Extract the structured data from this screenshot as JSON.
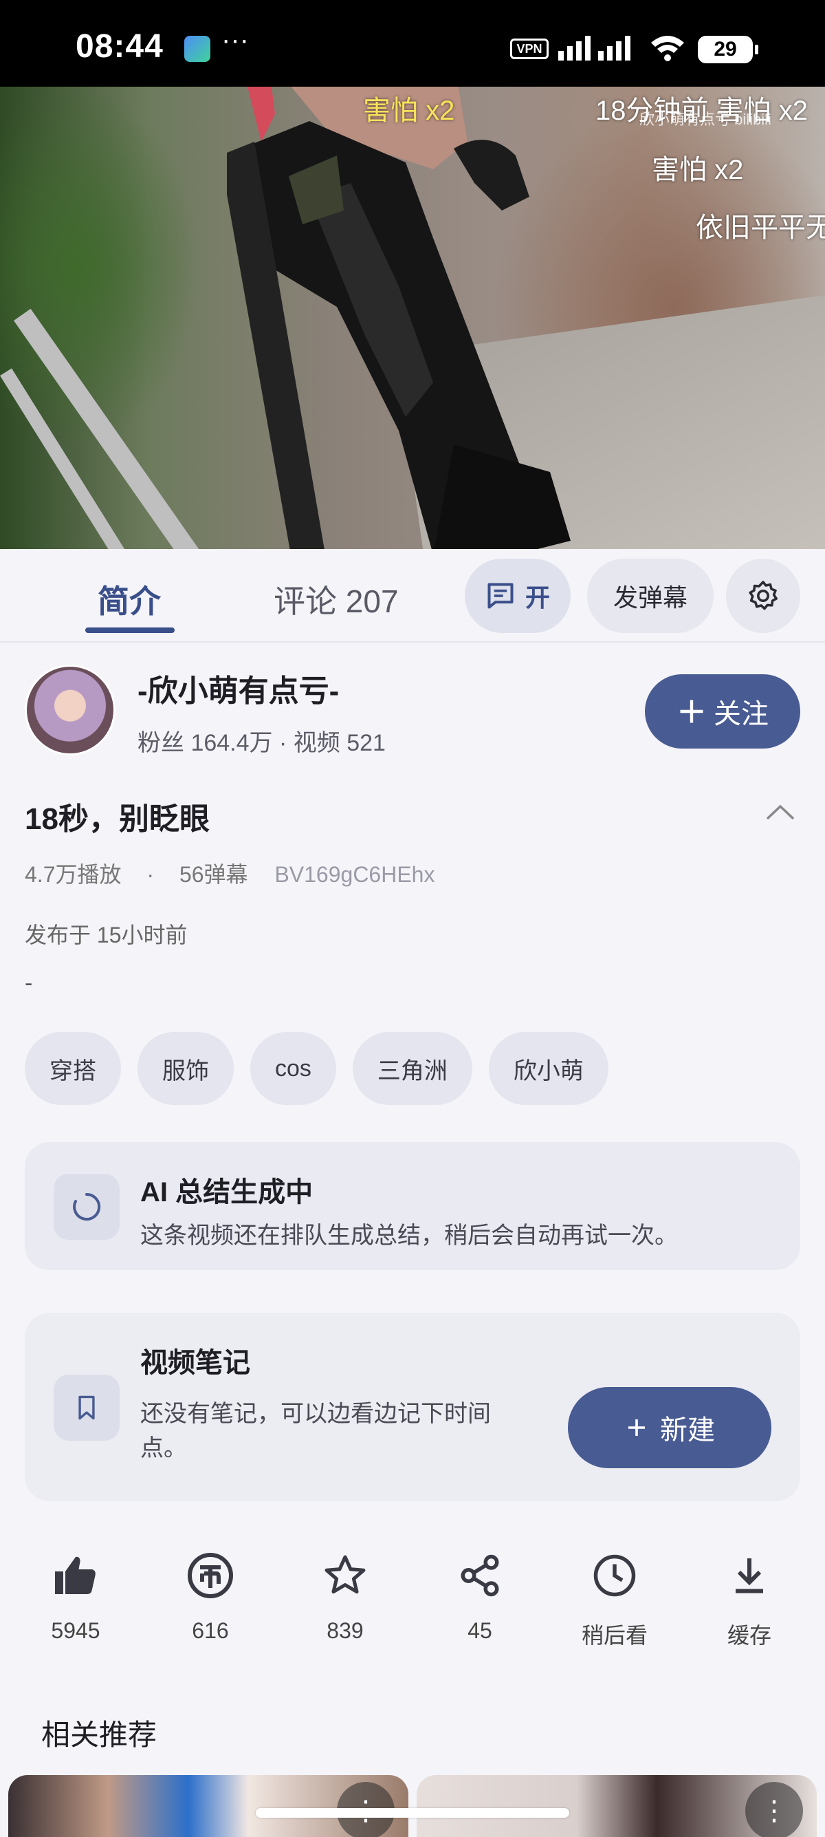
{
  "status_bar": {
    "time": "08:44",
    "more": "···",
    "vpn": "VPN",
    "battery": "29"
  },
  "video": {
    "danmaku": [
      {
        "text": "害怕 x2",
        "color": "yellow"
      },
      {
        "text": "18分钟前  害怕 x2",
        "color": "white"
      },
      {
        "text": "害怕 x2",
        "color": "white"
      },
      {
        "text": "依旧平平无",
        "color": "white"
      }
    ],
    "watermark": "欣小萌有点亏 bilibili"
  },
  "tabs": {
    "intro": "简介",
    "comments": "评论 207",
    "danmaku_toggle": "开",
    "send_danmaku": "发弹幕"
  },
  "uploader": {
    "name": "-欣小萌有点亏-",
    "stats": "粉丝 164.4万  ·  视频 521",
    "follow_label": "关注"
  },
  "video_info": {
    "title": "18秒，别眨眼",
    "plays": "4.7万播放",
    "danmaku_count": "56弹幕",
    "bvid": "BV169gC6HEhx",
    "published": "发布于 15小时前",
    "description": "-",
    "tags": [
      "穿搭",
      "服饰",
      "cos",
      "三角洲",
      "欣小萌"
    ]
  },
  "ai_summary": {
    "title": "AI 总结生成中",
    "text": "这条视频还在排队生成总结，稍后会自动再试一次。"
  },
  "notes": {
    "title": "视频笔记",
    "text": "还没有笔记，可以边看边记下时间点。",
    "new_label": "新建"
  },
  "actions": [
    {
      "icon": "thumb-up-icon",
      "label": "5945"
    },
    {
      "icon": "coin-icon",
      "label": "616"
    },
    {
      "icon": "star-icon",
      "label": "839"
    },
    {
      "icon": "share-icon",
      "label": "45"
    },
    {
      "icon": "clock-icon",
      "label": "稍后看"
    },
    {
      "icon": "download-icon",
      "label": "缓存"
    }
  ],
  "related": {
    "title": "相关推荐"
  },
  "colors": {
    "accent": "#485b92",
    "tab_active": "#3a4f8a",
    "background": "#f4f4f9"
  }
}
